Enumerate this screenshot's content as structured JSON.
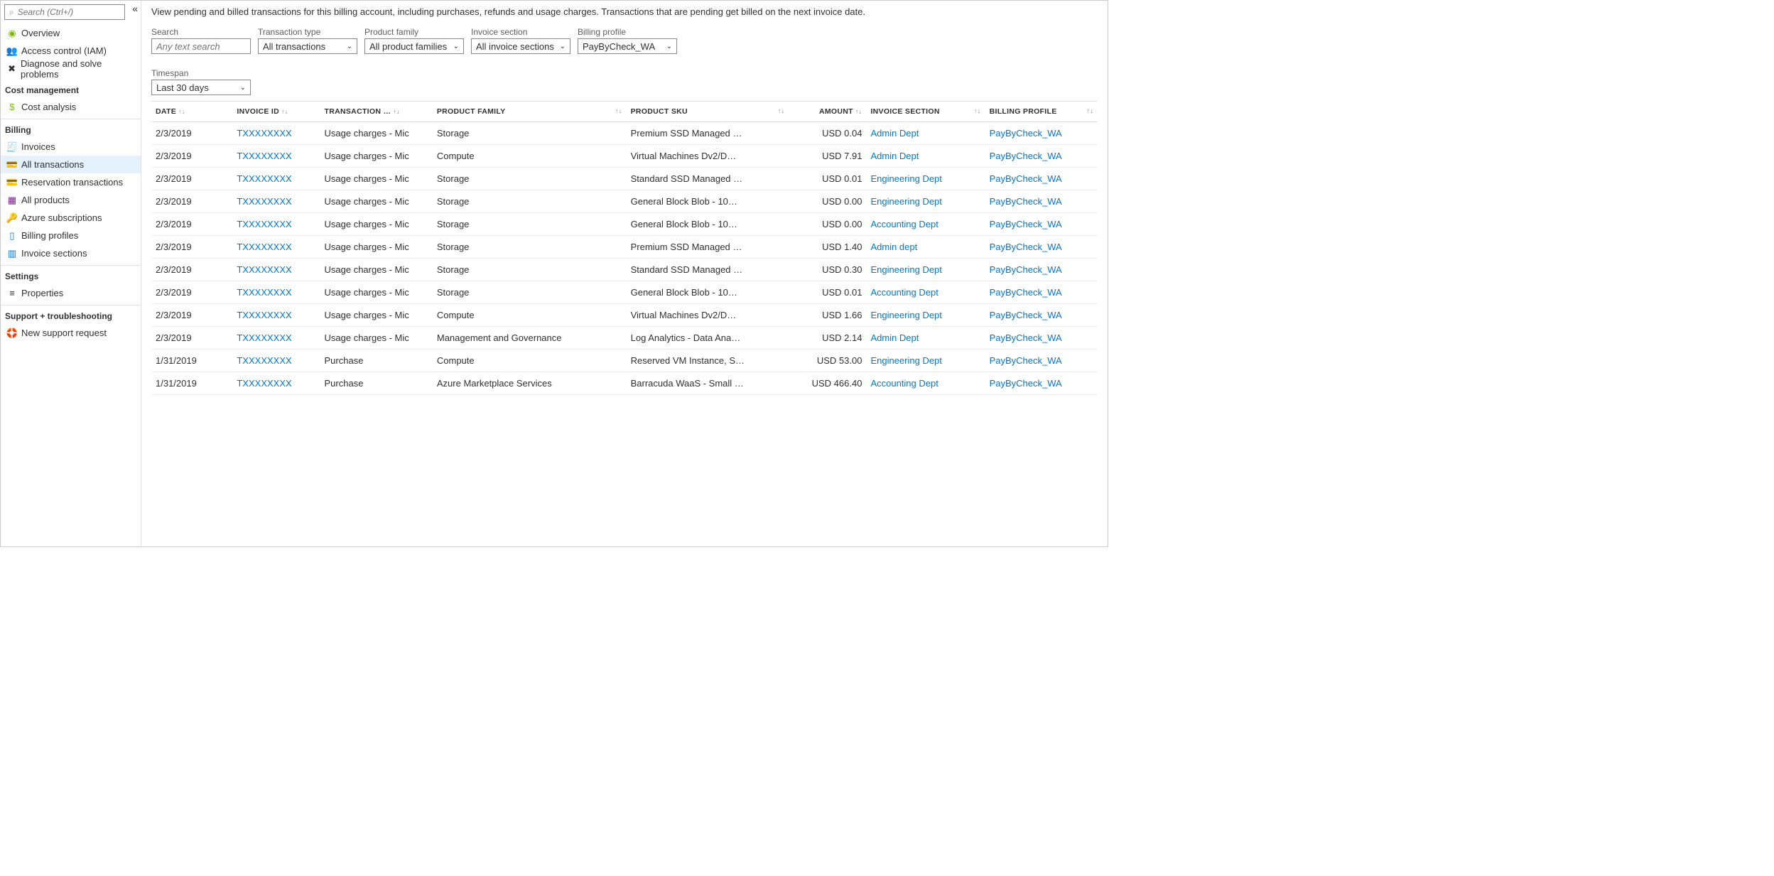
{
  "sidebar": {
    "search_placeholder": "Search (Ctrl+/)",
    "top": [
      {
        "icon": "overview",
        "label": "Overview"
      },
      {
        "icon": "iam",
        "label": "Access control (IAM)"
      },
      {
        "icon": "diagnose",
        "label": "Diagnose and solve problems"
      }
    ],
    "groups": [
      {
        "title": "Cost management",
        "items": [
          {
            "icon": "cost",
            "label": "Cost analysis"
          }
        ]
      },
      {
        "title": "Billing",
        "items": [
          {
            "icon": "invoice",
            "label": "Invoices"
          },
          {
            "icon": "trans",
            "label": "All transactions",
            "selected": true
          },
          {
            "icon": "reserv",
            "label": "Reservation transactions"
          },
          {
            "icon": "prod",
            "label": "All products"
          },
          {
            "icon": "key",
            "label": "Azure subscriptions"
          },
          {
            "icon": "profile",
            "label": "Billing profiles"
          },
          {
            "icon": "sections",
            "label": "Invoice sections"
          }
        ]
      },
      {
        "title": "Settings",
        "items": [
          {
            "icon": "props",
            "label": "Properties"
          }
        ]
      },
      {
        "title": "Support + troubleshooting",
        "items": [
          {
            "icon": "support",
            "label": "New support request"
          }
        ]
      }
    ]
  },
  "main": {
    "description": "View pending and billed transactions for this billing account, including purchases, refunds and usage charges. Transactions that are pending get billed on the next invoice date.",
    "filters": {
      "search_label": "Search",
      "search_placeholder": "Any text search",
      "type_label": "Transaction type",
      "type_value": "All transactions",
      "family_label": "Product family",
      "family_value": "All product families",
      "section_label": "Invoice section",
      "section_value": "All invoice sections",
      "profile_label": "Billing profile",
      "profile_value": "PayByCheck_WA",
      "timespan_label": "Timespan",
      "timespan_value": "Last 30 days"
    },
    "columns": {
      "date": "DATE",
      "invoice": "INVOICE ID",
      "type": "TRANSACTION …",
      "family": "PRODUCT FAMILY",
      "sku": "PRODUCT SKU",
      "amount": "AMOUNT",
      "section": "INVOICE SECTION",
      "profile": "BILLING PROFILE"
    },
    "rows": [
      {
        "date": "2/3/2019",
        "invoice": "TXXXXXXXX",
        "type": "Usage charges - Mic",
        "family": "Storage",
        "sku": "Premium SSD Managed …",
        "amount": "USD 0.04",
        "section": "Admin Dept",
        "profile": "PayByCheck_WA"
      },
      {
        "date": "2/3/2019",
        "invoice": "TXXXXXXXX",
        "type": "Usage charges - Mic",
        "family": "Compute",
        "sku": "Virtual Machines Dv2/D…",
        "amount": "USD 7.91",
        "section": "Admin Dept",
        "profile": "PayByCheck_WA"
      },
      {
        "date": "2/3/2019",
        "invoice": "TXXXXXXXX",
        "type": "Usage charges - Mic",
        "family": "Storage",
        "sku": "Standard SSD Managed …",
        "amount": "USD 0.01",
        "section": "Engineering Dept",
        "profile": "PayByCheck_WA"
      },
      {
        "date": "2/3/2019",
        "invoice": "TXXXXXXXX",
        "type": "Usage charges - Mic",
        "family": "Storage",
        "sku": "General Block Blob - 10…",
        "amount": "USD 0.00",
        "section": "Engineering Dept",
        "profile": "PayByCheck_WA"
      },
      {
        "date": "2/3/2019",
        "invoice": "TXXXXXXXX",
        "type": "Usage charges - Mic",
        "family": "Storage",
        "sku": "General Block Blob - 10…",
        "amount": "USD 0.00",
        "section": "Accounting Dept",
        "profile": "PayByCheck_WA"
      },
      {
        "date": "2/3/2019",
        "invoice": "TXXXXXXXX",
        "type": "Usage charges - Mic",
        "family": "Storage",
        "sku": "Premium SSD Managed …",
        "amount": "USD 1.40",
        "section": "Admin dept",
        "profile": "PayByCheck_WA"
      },
      {
        "date": "2/3/2019",
        "invoice": "TXXXXXXXX",
        "type": "Usage charges - Mic",
        "family": "Storage",
        "sku": "Standard SSD Managed …",
        "amount": "USD 0.30",
        "section": "Engineering Dept",
        "profile": "PayByCheck_WA"
      },
      {
        "date": "2/3/2019",
        "invoice": "TXXXXXXXX",
        "type": "Usage charges - Mic",
        "family": "Storage",
        "sku": "General Block Blob - 10…",
        "amount": "USD 0.01",
        "section": "Accounting Dept",
        "profile": "PayByCheck_WA"
      },
      {
        "date": "2/3/2019",
        "invoice": "TXXXXXXXX",
        "type": "Usage charges - Mic",
        "family": "Compute",
        "sku": "Virtual Machines Dv2/D…",
        "amount": "USD 1.66",
        "section": "Engineering Dept",
        "profile": "PayByCheck_WA"
      },
      {
        "date": "2/3/2019",
        "invoice": "TXXXXXXXX",
        "type": "Usage charges - Mic",
        "family": "Management and Governance",
        "sku": "Log Analytics - Data Ana…",
        "amount": "USD 2.14",
        "section": "Admin Dept",
        "profile": "PayByCheck_WA"
      },
      {
        "date": "1/31/2019",
        "invoice": "TXXXXXXXX",
        "type": "Purchase",
        "family": "Compute",
        "sku": "Reserved VM Instance, S…",
        "amount": "USD 53.00",
        "section": "Engineering Dept",
        "profile": "PayByCheck_WA"
      },
      {
        "date": "1/31/2019",
        "invoice": "TXXXXXXXX",
        "type": "Purchase",
        "family": "Azure Marketplace Services",
        "sku": "Barracuda WaaS - Small …",
        "amount": "USD 466.40",
        "section": "Accounting Dept",
        "profile": "PayByCheck_WA"
      }
    ]
  }
}
